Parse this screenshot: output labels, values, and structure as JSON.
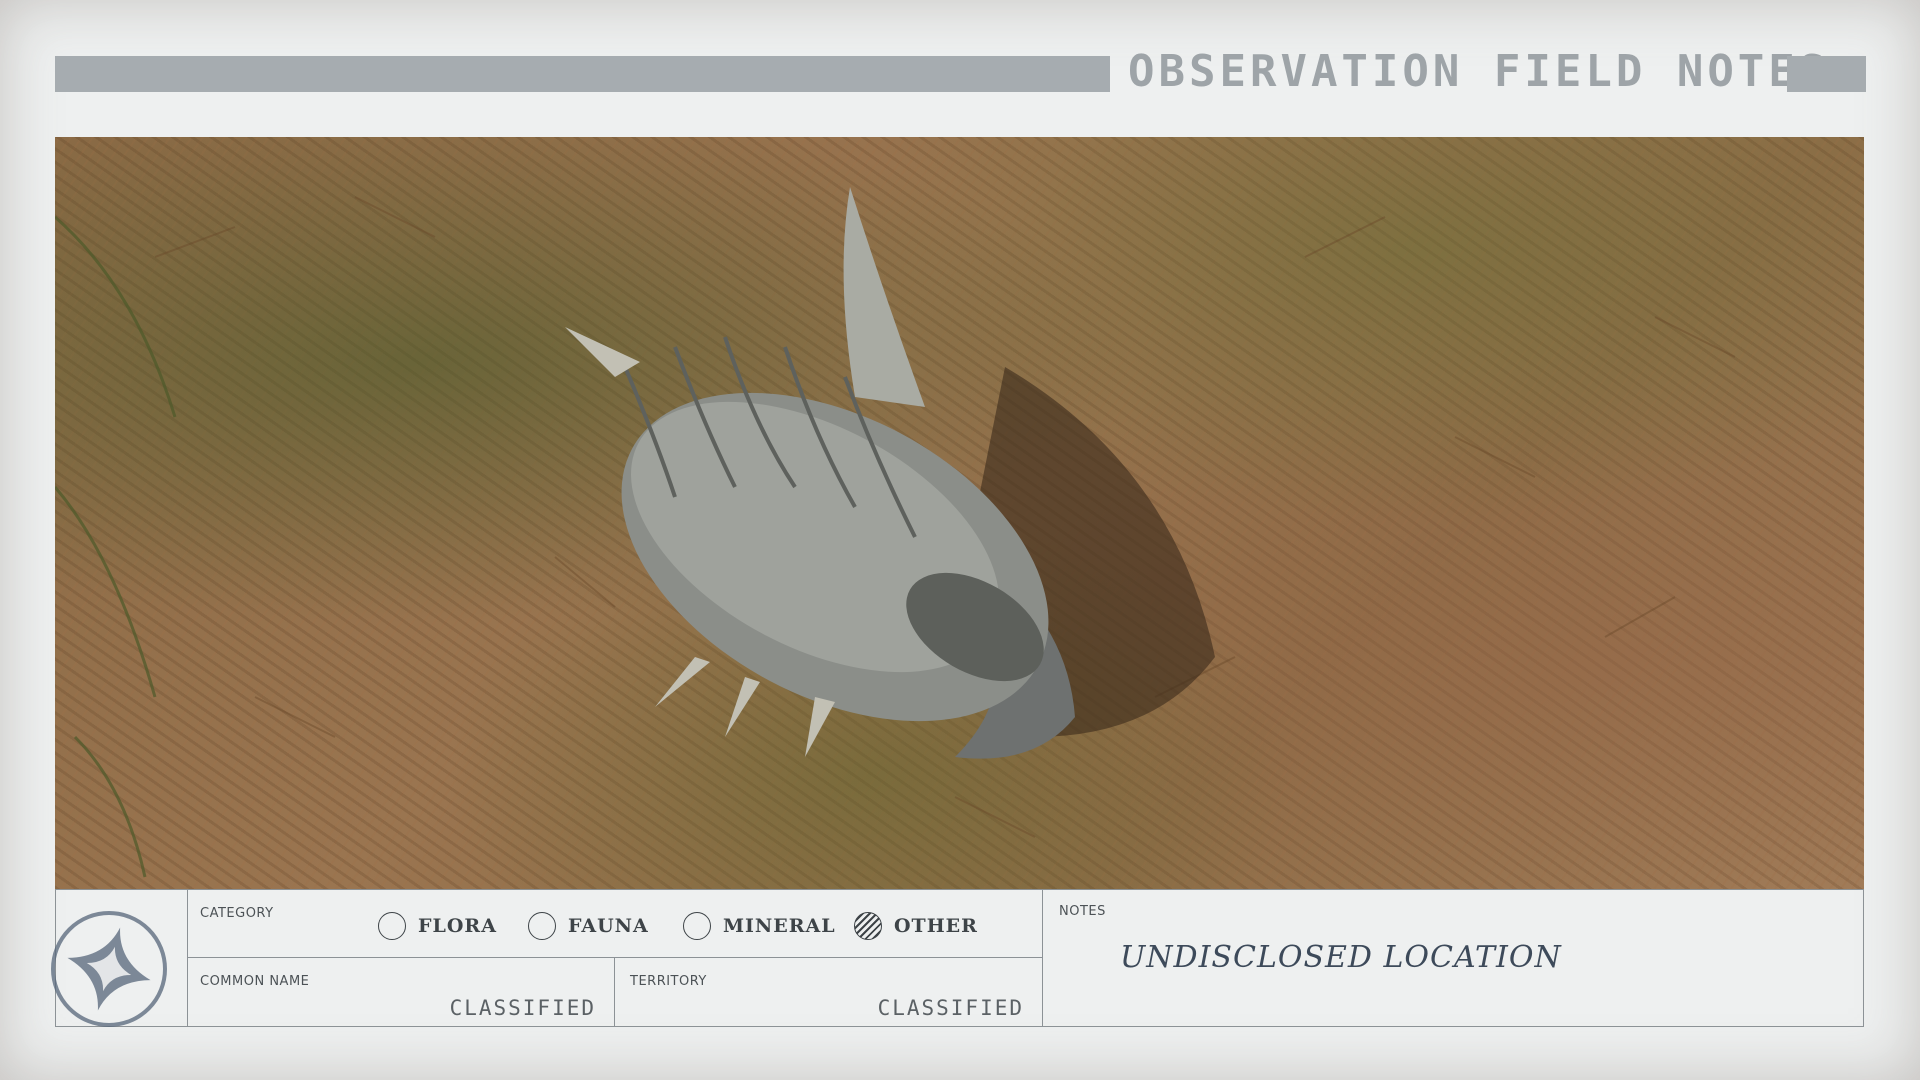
{
  "header": {
    "title": "OBSERVATION FIELD NOTES"
  },
  "photo": {
    "subject_icon": "creature-photo"
  },
  "emblem": {
    "icon": "four-point-star-seal-icon"
  },
  "category": {
    "label": "CATEGORY",
    "options": [
      {
        "label": "FLORA",
        "checked": false
      },
      {
        "label": "FAUNA",
        "checked": false
      },
      {
        "label": "MINERAL",
        "checked": false
      },
      {
        "label": "OTHER",
        "checked": true
      }
    ]
  },
  "common_name": {
    "label": "COMMON NAME",
    "value": "CLASSIFIED"
  },
  "territory": {
    "label": "TERRITORY",
    "value": "CLASSIFIED"
  },
  "notes": {
    "label": "NOTES",
    "value": "UNDISCLOSED LOCATION"
  },
  "colors": {
    "paper": "#eef0f0",
    "ink": "#3e4448",
    "title_bar": "#a6acb0",
    "handwriting": "#3d4a5a"
  }
}
